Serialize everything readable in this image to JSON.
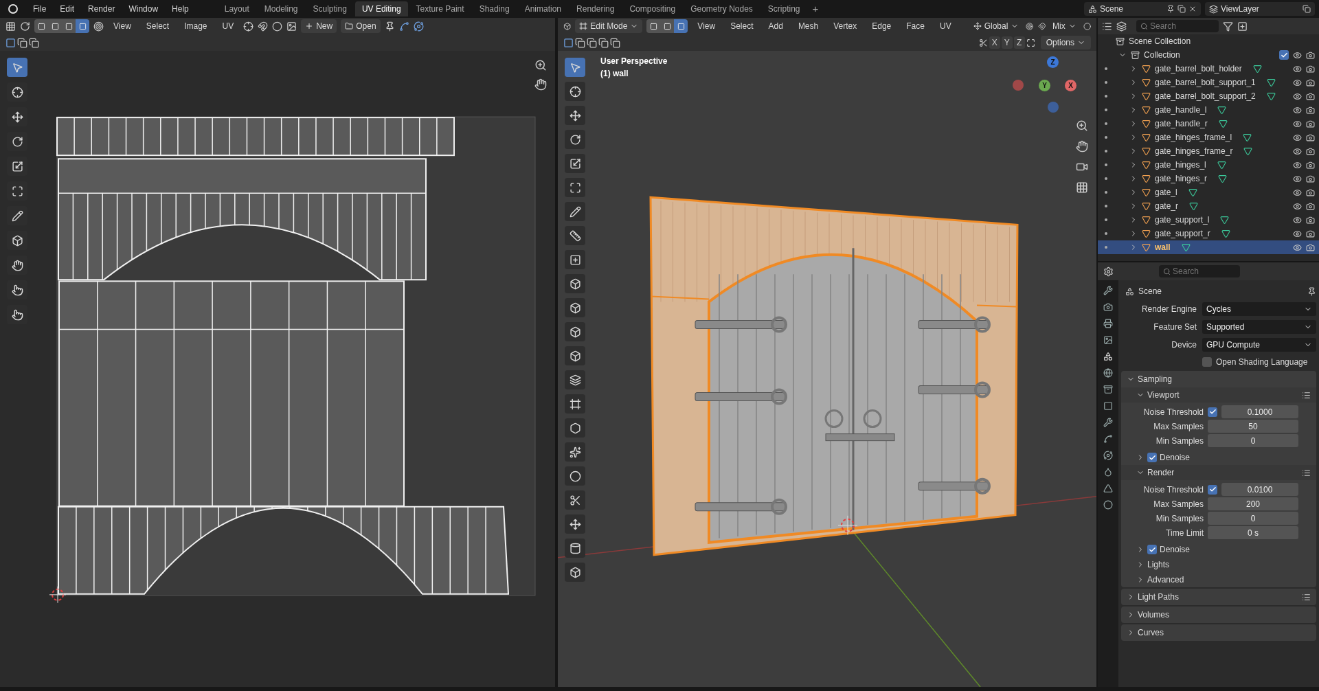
{
  "menu": [
    "File",
    "Edit",
    "Render",
    "Window",
    "Help"
  ],
  "workspaces": [
    {
      "label": "Layout",
      "selected": false
    },
    {
      "label": "Modeling",
      "selected": false
    },
    {
      "label": "Sculpting",
      "selected": false
    },
    {
      "label": "UV Editing",
      "selected": true
    },
    {
      "label": "Texture Paint",
      "selected": false
    },
    {
      "label": "Shading",
      "selected": false
    },
    {
      "label": "Animation",
      "selected": false
    },
    {
      "label": "Rendering",
      "selected": false
    },
    {
      "label": "Compositing",
      "selected": false
    },
    {
      "label": "Geometry Nodes",
      "selected": false
    },
    {
      "label": "Scripting",
      "selected": false
    }
  ],
  "add_workspace": "+",
  "scene": "Scene",
  "view_layer": "ViewLayer",
  "uv_editor": {
    "menus": [
      "View",
      "Select",
      "Image",
      "UV"
    ],
    "new_button": "New",
    "open_button": "Open",
    "select_modes": [
      {
        "selected": false
      },
      {
        "selected": false
      },
      {
        "selected": false
      },
      {
        "selected": true
      }
    ],
    "tools": [
      {
        "selected": true
      },
      {
        "selected": false
      },
      {
        "selected": false
      },
      {
        "selected": false
      },
      {
        "selected": false
      },
      {
        "selected": false
      },
      {
        "selected": false
      },
      {
        "selected": false
      },
      {
        "selected": false
      },
      {
        "selected": false
      },
      {
        "selected": false
      }
    ]
  },
  "viewport": {
    "mode": "Edit Mode",
    "menus": [
      "View",
      "Select",
      "Add",
      "Mesh",
      "Vertex",
      "Edge",
      "Face",
      "UV"
    ],
    "orientation": "Global",
    "pivot": "Mix",
    "select_modes": [
      {
        "selected": false
      },
      {
        "selected": false
      },
      {
        "selected": true
      }
    ],
    "mirror_axes": [
      "X",
      "Y",
      "Z"
    ],
    "options": "Options",
    "overlay_lines": [
      "User Perspective",
      "(1) wall"
    ],
    "gizmo_labels": [
      "Z",
      "Y",
      "X"
    ],
    "tools": [
      {
        "selected": true
      },
      {
        "selected": false
      },
      {
        "selected": false
      },
      {
        "selected": false
      },
      {
        "selected": false
      },
      {
        "selected": false
      },
      {
        "selected": false
      },
      {
        "selected": false
      },
      {
        "selected": false
      },
      {
        "selected": false
      },
      {
        "selected": false
      },
      {
        "selected": false
      },
      {
        "selected": false
      },
      {
        "selected": false
      },
      {
        "selected": false
      },
      {
        "selected": false
      },
      {
        "selected": false
      },
      {
        "selected": false
      },
      {
        "selected": false
      },
      {
        "selected": false
      },
      {
        "selected": false
      },
      {
        "selected": false
      }
    ]
  },
  "outliner": {
    "search_placeholder": "Search",
    "scene_collection": "Scene Collection",
    "collection": {
      "label": "Collection",
      "checked": true
    },
    "items": [
      {
        "name": "gate_barrel_bolt_holder",
        "selected": false
      },
      {
        "name": "gate_barrel_bolt_support_1",
        "selected": false
      },
      {
        "name": "gate_barrel_bolt_support_2",
        "selected": false
      },
      {
        "name": "gate_handle_l",
        "selected": false
      },
      {
        "name": "gate_handle_r",
        "selected": false
      },
      {
        "name": "gate_hinges_frame_l",
        "selected": false
      },
      {
        "name": "gate_hinges_frame_r",
        "selected": false
      },
      {
        "name": "gate_hinges_l",
        "selected": false
      },
      {
        "name": "gate_hinges_r",
        "selected": false
      },
      {
        "name": "gate_l",
        "selected": false
      },
      {
        "name": "gate_r",
        "selected": false
      },
      {
        "name": "gate_support_l",
        "selected": false
      },
      {
        "name": "gate_support_r",
        "selected": false
      },
      {
        "name": "wall",
        "selected": true
      }
    ]
  },
  "properties": {
    "search_placeholder": "Search",
    "context": "Scene",
    "fields": [
      {
        "label": "Render Engine",
        "value": "Cycles"
      },
      {
        "label": "Feature Set",
        "value": "Supported"
      },
      {
        "label": "Device",
        "value": "GPU Compute"
      }
    ],
    "osl": {
      "label": "Open Shading Language",
      "checked": false
    },
    "panels": [
      {
        "title": "Sampling",
        "expanded": true,
        "presets": false,
        "children": [
          {
            "kind": "sub",
            "title": "Viewport",
            "expanded": true,
            "presets": true,
            "rows": [
              {
                "kind": "check_number",
                "label": "Noise Threshold",
                "checked": true,
                "value": "0.1000"
              },
              {
                "kind": "number",
                "label": "Max Samples",
                "value": "50"
              },
              {
                "kind": "number",
                "label": "Min Samples",
                "value": "0"
              }
            ]
          },
          {
            "kind": "check",
            "title": "Denoise",
            "checked": true,
            "expanded": false
          },
          {
            "kind": "sub",
            "title": "Render",
            "expanded": true,
            "presets": true,
            "rows": [
              {
                "kind": "check_number",
                "label": "Noise Threshold",
                "checked": true,
                "value": "0.0100"
              },
              {
                "kind": "number",
                "label": "Max Samples",
                "value": "200"
              },
              {
                "kind": "number",
                "label": "Min Samples",
                "value": "0"
              },
              {
                "kind": "number",
                "label": "Time Limit",
                "value": "0 s"
              }
            ]
          },
          {
            "kind": "check",
            "title": "Denoise",
            "checked": true,
            "expanded": false
          },
          {
            "kind": "sub",
            "title": "Lights",
            "expanded": false,
            "presets": false
          },
          {
            "kind": "sub",
            "title": "Advanced",
            "expanded": false,
            "presets": false
          }
        ]
      },
      {
        "title": "Light Paths",
        "expanded": false,
        "presets": true
      },
      {
        "title": "Volumes",
        "expanded": false,
        "presets": false
      },
      {
        "title": "Curves",
        "expanded": false,
        "presets": false
      }
    ]
  }
}
